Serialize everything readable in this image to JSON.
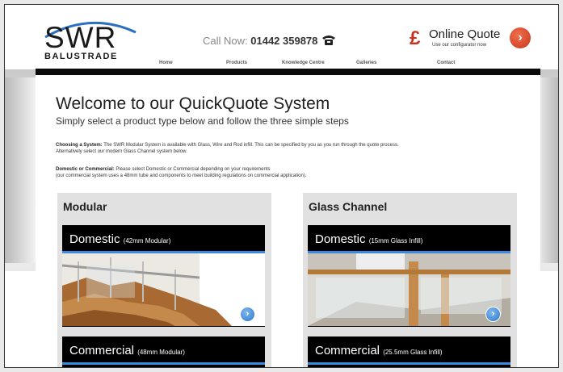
{
  "header": {
    "logo_main": "SWR",
    "logo_sub": "BALUSTRADE",
    "call_prefix": "Call Now:",
    "call_number": "01442 359878",
    "quote_title": "Online Quote",
    "quote_sub": "Use our configurator now"
  },
  "nav": [
    {
      "label": "Home"
    },
    {
      "label": "Products"
    },
    {
      "label": "Knowledge Centre"
    },
    {
      "label": "Galleries"
    },
    {
      "label": "Contact"
    }
  ],
  "main": {
    "title": "Welcome to our QuickQuote System",
    "subtitle": "Simply select a product type below and follow the three simple steps",
    "choosing_label": "Choosing a System:",
    "choosing_text": "The SWR Modular System is available with Glass, Wire and Rod infill. This can be specified by you as you run through the quote process.",
    "choosing_text2": "Alternatively select our modern Glass Channel system below.",
    "domcom_label": "Domestic or Commercial:",
    "domcom_text": "Please select Domestic or Commercial depending on your requirements",
    "domcom_text2": "(our commercial system uses a 48mm tube and components to meet building regulations on commercial application)."
  },
  "panels": {
    "modular": {
      "title": "Modular",
      "card1_title": "Domestic",
      "card1_sub": "(42mm Modular)",
      "card2_title": "Commercial",
      "card2_sub": "(48mm Modular)"
    },
    "glass": {
      "title": "Glass Channel",
      "card1_title": "Domestic",
      "card1_sub": "(15mm Glass Infill)",
      "card2_title": "Commercial",
      "card2_sub": "(25.5mm Glass Infill)"
    }
  },
  "colors": {
    "accent_red": "#c7361a",
    "accent_blue": "#3a8be0"
  }
}
